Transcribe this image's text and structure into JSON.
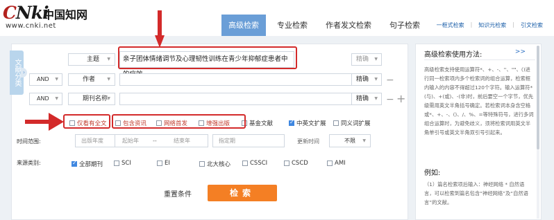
{
  "logo": {
    "mark": "CNki",
    "cn": "中国知网",
    "url": "www.cnki.net"
  },
  "nav": {
    "tabs": [
      "高级检索",
      "专业检索",
      "作者发文检索",
      "句子检索"
    ]
  },
  "top_links": [
    "一框式检索",
    "知识元检索",
    "引文检索"
  ],
  "side_tab": "文献分类",
  "rows": [
    {
      "logic": "",
      "field": "主题",
      "value": "亲子团体情绪调节及心理韧性训练在青少年抑郁症患者中的疗效",
      "match": "精确"
    },
    {
      "logic": "AND",
      "field": "作者",
      "value": "",
      "match": "精确"
    },
    {
      "logic": "AND",
      "field": "期刊名称",
      "value": "",
      "match": "精确"
    }
  ],
  "options": [
    {
      "label": "仅看有全文",
      "checked": false,
      "highlight": true
    },
    {
      "label": "包含资讯",
      "checked": false,
      "highlight": true
    },
    {
      "label": "网络首发",
      "checked": false,
      "highlight": true
    },
    {
      "label": "增强出版",
      "checked": false,
      "highlight": true
    },
    {
      "label": "基金文献",
      "checked": false,
      "highlight": false
    },
    {
      "label": "中英文扩展",
      "checked": true,
      "highlight": false
    },
    {
      "label": "同义词扩展",
      "checked": false,
      "highlight": false
    }
  ],
  "time": {
    "label": "时间范围:",
    "pub_year": "出版年度",
    "start_year": "起始年",
    "dash": "--",
    "end_year": "结束年",
    "period": "指定期",
    "update_label": "更新时间",
    "update_value": "不限"
  },
  "source": {
    "label": "来源类别:",
    "items": [
      {
        "label": "全部期刊",
        "checked": true
      },
      {
        "label": "SCI",
        "checked": false
      },
      {
        "label": "EI",
        "checked": false
      },
      {
        "label": "北大核心",
        "checked": false
      },
      {
        "label": "CSSCI",
        "checked": false
      },
      {
        "label": "CSCD",
        "checked": false
      },
      {
        "label": "AMI",
        "checked": false
      }
    ]
  },
  "actions": {
    "reset": "重置条件",
    "search": "检索"
  },
  "help": {
    "title": "高级检索使用方法:",
    "more": ">>",
    "body": "高级检索支持使用运算符*、+、-、''、\"\"、()进行同一检索项内多个检索词的组合运算，检索框内输入的内容不得超过120个字符。输入运算符*(与)、+(或)、-(非)时，前后要空一个字节，优先级需用英文半角括号确定。若检索词本身含空格或*、+、-、()、/、%、=等特殊符号，进行多词组合运算时，为避免歧义，须将检索词用英文半角单引号或英文半角双引号引起来。",
    "example_title": "例如:",
    "example_body": "（1）篇名检索项后输入：神经网络 * 自然语言，可以检索到篇名包含“神经网络”及“自然语言”的文献。"
  }
}
